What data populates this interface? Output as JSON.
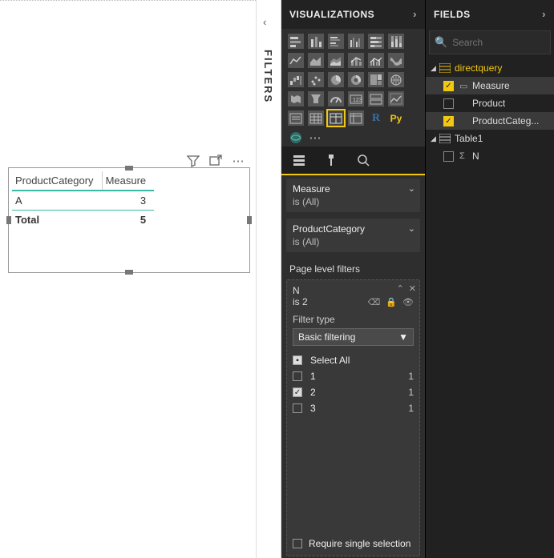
{
  "canvas": {
    "table": {
      "headers": [
        "ProductCategory",
        "Measure"
      ],
      "rows": [
        {
          "cat": "A",
          "val": "3"
        }
      ],
      "total_label": "Total",
      "total_val": "5"
    }
  },
  "filters_tab_label": "FILTERS",
  "viz_pane": {
    "title": "VISUALIZATIONS",
    "visual_filters": [
      {
        "name": "Measure",
        "value": "is (All)"
      },
      {
        "name": "ProductCategory",
        "value": "is (All)"
      }
    ],
    "page_filters_label": "Page level filters",
    "page_filter": {
      "field": "N",
      "summary": "is 2",
      "filter_type_label": "Filter type",
      "filter_type_value": "Basic filtering",
      "select_all_label": "Select All",
      "options": [
        {
          "label": "1",
          "count": "1",
          "checked": false
        },
        {
          "label": "2",
          "count": "1",
          "checked": true
        },
        {
          "label": "3",
          "count": "1",
          "checked": false
        }
      ],
      "require_single_label": "Require single selection",
      "require_single_checked": false
    }
  },
  "fields_pane": {
    "title": "FIELDS",
    "search_placeholder": "Search",
    "tables": [
      {
        "name": "directquery",
        "highlight": true,
        "fields": [
          {
            "name": "Measure",
            "checked": true,
            "glyph": "▭"
          },
          {
            "name": "Product",
            "checked": false,
            "glyph": ""
          },
          {
            "name": "ProductCateg...",
            "checked": true,
            "glyph": ""
          }
        ]
      },
      {
        "name": "Table1",
        "highlight": false,
        "fields": [
          {
            "name": "N",
            "checked": false,
            "glyph": "Σ"
          }
        ]
      }
    ]
  }
}
